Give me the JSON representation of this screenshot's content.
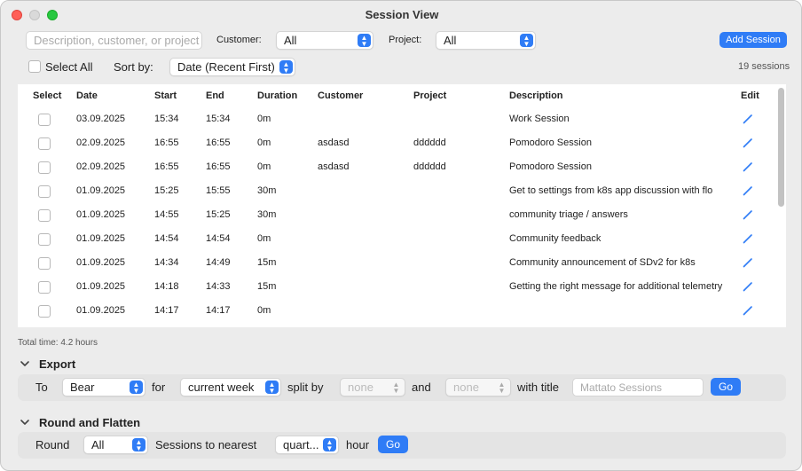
{
  "window": {
    "title": "Session View"
  },
  "filters": {
    "search_placeholder": "Description, customer, or project",
    "customer_label": "Customer:",
    "customer_value": "All",
    "project_label": "Project:",
    "project_value": "All",
    "add_session_label": "Add Session",
    "select_all_label": "Select All",
    "sort_by_label": "Sort by:",
    "sort_value": "Date (Recent First)",
    "session_count": "19 sessions"
  },
  "table": {
    "columns": [
      "Select",
      "Date",
      "Start",
      "End",
      "Duration",
      "Customer",
      "Project",
      "Description",
      "Edit"
    ],
    "rows": [
      {
        "date": "03.09.2025",
        "start": "15:34",
        "end": "15:34",
        "duration": "0m",
        "customer": "",
        "project": "",
        "description": "Work Session"
      },
      {
        "date": "02.09.2025",
        "start": "16:55",
        "end": "16:55",
        "duration": "0m",
        "customer": "asdasd",
        "project": "dddddd",
        "description": "Pomodoro Session"
      },
      {
        "date": "02.09.2025",
        "start": "16:55",
        "end": "16:55",
        "duration": "0m",
        "customer": "asdasd",
        "project": "dddddd",
        "description": "Pomodoro Session"
      },
      {
        "date": "01.09.2025",
        "start": "15:25",
        "end": "15:55",
        "duration": "30m",
        "customer": "",
        "project": "",
        "description": "Get to settings from k8s app discussion with flo"
      },
      {
        "date": "01.09.2025",
        "start": "14:55",
        "end": "15:25",
        "duration": "30m",
        "customer": "",
        "project": "",
        "description": "community triage / answers"
      },
      {
        "date": "01.09.2025",
        "start": "14:54",
        "end": "14:54",
        "duration": "0m",
        "customer": "",
        "project": "",
        "description": "Community feedback"
      },
      {
        "date": "01.09.2025",
        "start": "14:34",
        "end": "14:49",
        "duration": "15m",
        "customer": "",
        "project": "",
        "description": "Community announcement of SDv2 for k8s"
      },
      {
        "date": "01.09.2025",
        "start": "14:18",
        "end": "14:33",
        "duration": "15m",
        "customer": "",
        "project": "",
        "description": "Getting the right message for additional telemetry"
      },
      {
        "date": "01.09.2025",
        "start": "14:17",
        "end": "14:17",
        "duration": "0m",
        "customer": "",
        "project": "",
        "description": ""
      }
    ]
  },
  "total_time": "Total time: 4.2 hours",
  "export": {
    "title": "Export",
    "to_label": "To",
    "to_value": "Bear",
    "for_label": "for",
    "for_value": "current week",
    "split_label": "split by",
    "split_value": "none",
    "and_label": "and",
    "and_value": "none",
    "title_label": "with title",
    "title_placeholder": "Mattato Sessions",
    "go_label": "Go"
  },
  "round": {
    "title": "Round and Flatten",
    "round_label": "Round",
    "round_value": "All",
    "nearest_label": "Sessions to nearest",
    "nearest_value": "quart...",
    "hour_label": "hour",
    "go_label": "Go"
  },
  "colors": {
    "accent": "#2f7cf6",
    "close": "#ff5f57",
    "maximize": "#28c840"
  }
}
